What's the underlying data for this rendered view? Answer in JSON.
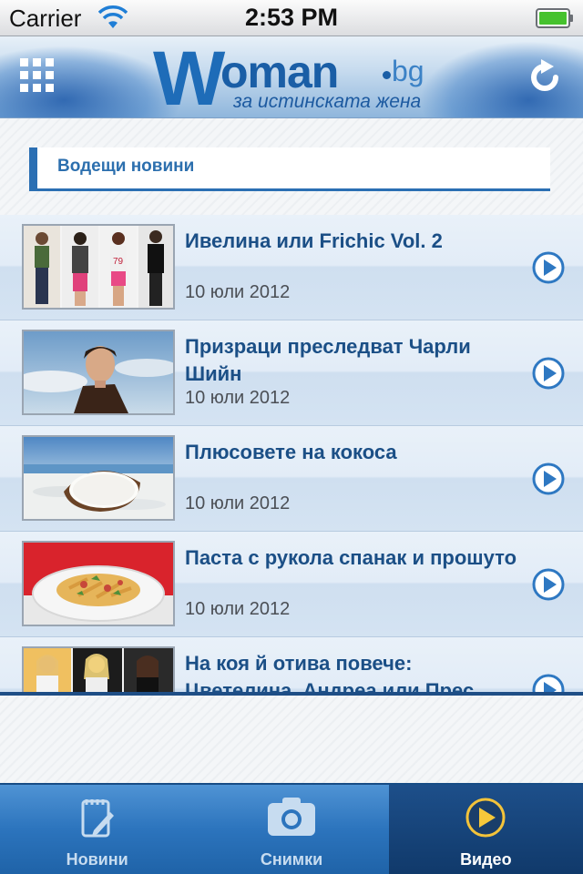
{
  "status_bar": {
    "carrier": "Carrier",
    "time": "2:53 PM",
    "battery_color": "#46c22e"
  },
  "header": {
    "logo_w": "W",
    "logo_oman": "oman",
    "logo_bg": "bg",
    "tagline": "за истинската жена",
    "left_icon": "grid-menu-icon",
    "right_icon": "refresh-icon",
    "accent_color": "#1e6cb8"
  },
  "section": {
    "title": "Водещи новини"
  },
  "news": [
    {
      "title": "Ивелина или Frichic Vol. 2",
      "date": "10 юли 2012",
      "thumb": "fashion-collage"
    },
    {
      "title": "Призраци преследват Чарли Шийн",
      "date": "10 юли 2012",
      "thumb": "man-portrait"
    },
    {
      "title": "Плюсовете на кокоса",
      "date": "10 юли 2012",
      "thumb": "coconut"
    },
    {
      "title": "Паста с рукола спанак и прошуто",
      "date": "10 юли 2012",
      "thumb": "pasta-plate"
    },
    {
      "title": "На коя й отива повече: Цветелина, Андреа или Прес...",
      "date": "",
      "thumb": "three-women"
    }
  ],
  "tab_bar": {
    "tabs": [
      {
        "label": "Новини",
        "icon": "notepad-icon",
        "active": false
      },
      {
        "label": "Снимки",
        "icon": "camera-icon",
        "active": false
      },
      {
        "label": "Видео",
        "icon": "play-circle-icon",
        "active": true
      }
    ]
  }
}
